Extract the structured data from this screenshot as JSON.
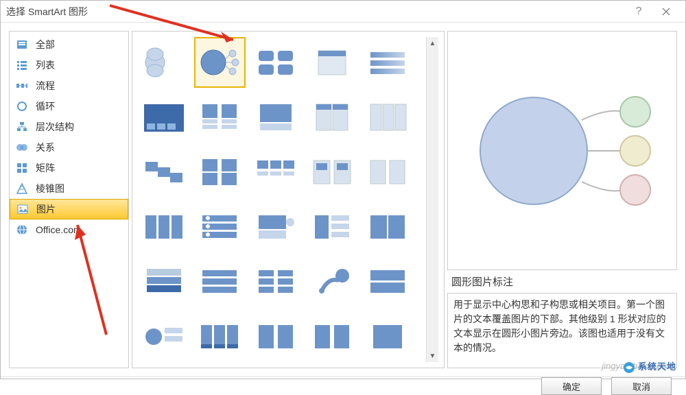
{
  "titlebar": {
    "title": "选择 SmartArt 图形"
  },
  "sidebar": {
    "items": [
      {
        "label": "全部"
      },
      {
        "label": "列表"
      },
      {
        "label": "流程"
      },
      {
        "label": "循环"
      },
      {
        "label": "层次结构"
      },
      {
        "label": "关系"
      },
      {
        "label": "矩阵"
      },
      {
        "label": "棱锥图"
      },
      {
        "label": "图片"
      },
      {
        "label": "Office.com"
      }
    ]
  },
  "preview": {
    "title": "圆形图片标注",
    "desc": "用于显示中心构思和子构思或相关项目。第一个图片的文本覆盖图片的下部。其他级别 1 形状对应的文本显示在圆形小图片旁边。该图也适用于没有文本的情况。"
  },
  "footer": {
    "ok": "确定",
    "cancel": "取消"
  },
  "watermark": "jingyan.baidu.com",
  "brand": "系统天地"
}
